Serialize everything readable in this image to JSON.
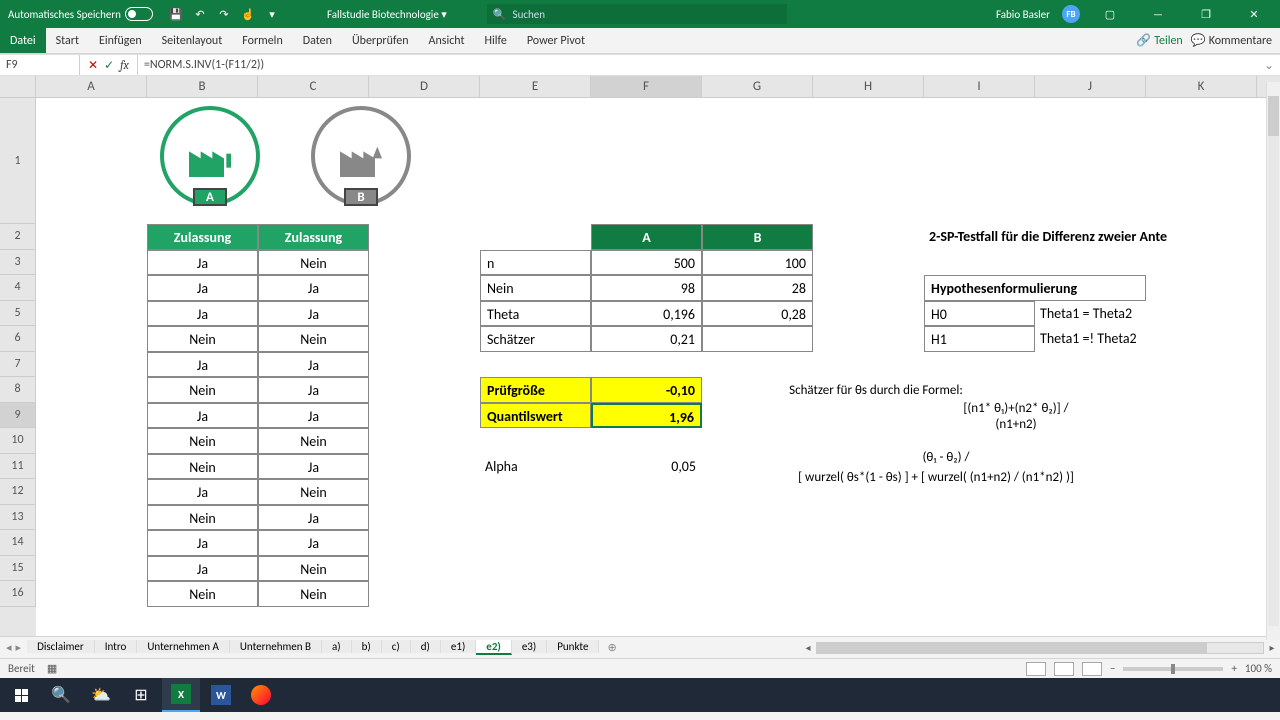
{
  "titlebar": {
    "autosave": "Automatisches Speichern",
    "docname": "Fallstudie Biotechnologie",
    "search_placeholder": "Suchen",
    "user": "Fabio Basler",
    "user_initials": "FB"
  },
  "ribbon": {
    "tabs": [
      "Datei",
      "Start",
      "Einfügen",
      "Seitenlayout",
      "Formeln",
      "Daten",
      "Überprüfen",
      "Ansicht",
      "Hilfe",
      "Power Pivot"
    ],
    "share": "Teilen",
    "comments": "Kommentare"
  },
  "formulabar": {
    "cellref": "F9",
    "formula": "=NORM.S.INV(1-(F11/2))"
  },
  "columns": [
    "A",
    "B",
    "C",
    "D",
    "E",
    "F",
    "G",
    "H",
    "I",
    "J",
    "K"
  ],
  "row_labels": [
    "1",
    "2",
    "3",
    "4",
    "5",
    "6",
    "7",
    "8",
    "9",
    "10",
    "11",
    "12",
    "13",
    "14",
    "15",
    "16"
  ],
  "data_headers": {
    "b2": "Zulassung",
    "c2": "Zulassung"
  },
  "bc_rows": [
    {
      "b": "Ja",
      "c": "Nein"
    },
    {
      "b": "Ja",
      "c": "Ja"
    },
    {
      "b": "Ja",
      "c": "Ja"
    },
    {
      "b": "Nein",
      "c": "Nein"
    },
    {
      "b": "Ja",
      "c": "Ja"
    },
    {
      "b": "Nein",
      "c": "Ja"
    },
    {
      "b": "Ja",
      "c": "Ja"
    },
    {
      "b": "Nein",
      "c": "Nein"
    },
    {
      "b": "Nein",
      "c": "Ja"
    },
    {
      "b": "Ja",
      "c": "Nein"
    },
    {
      "b": "Nein",
      "c": "Ja"
    },
    {
      "b": "Ja",
      "c": "Ja"
    },
    {
      "b": "Ja",
      "c": "Nein"
    },
    {
      "b": "Nein",
      "c": "Nein"
    }
  ],
  "stats": {
    "headA": "A",
    "headB": "B",
    "rows": [
      {
        "label": "n",
        "a": "500",
        "b": "100"
      },
      {
        "label": "Nein",
        "a": "98",
        "b": "28"
      },
      {
        "label": "Theta",
        "a": "0,196",
        "b": "0,28"
      },
      {
        "label": "Schätzer",
        "a": "0,21",
        "b": ""
      }
    ],
    "pruef_label": "Prüfgröße",
    "pruef_val": "-0,10",
    "quant_label": "Quantilswert",
    "quant_val": "1,96",
    "alpha_label": "Alpha",
    "alpha_val": "0,05"
  },
  "right": {
    "title": "2-SP-Testfall für die Differenz zweier Ante",
    "hypo": "Hypothesenformulierung",
    "h0_l": "H0",
    "h0_r": "Theta1 = Theta2",
    "h1_l": "H1",
    "h1_r": "Theta1 =! Theta2",
    "formel_intro": "Schätzer für θs durch die Formel:",
    "formel1": "[(n1* θ₁)+(n2* θ₂)] /",
    "formel2": "(n1+n2)",
    "formel3": "(θ₁ - θ₂) /",
    "formel4": "[ wurzel( θs*(1 - θs) ] + [ wurzel( (n1+n2) / (n1*n2) )]"
  },
  "sheets": [
    "Disclaimer",
    "Intro",
    "Unternehmen A",
    "Unternehmen B",
    "a)",
    "b)",
    "c)",
    "d)",
    "e1)",
    "e2)",
    "e3)",
    "Punkte"
  ],
  "active_sheet": "e2)",
  "status": {
    "ready": "Bereit",
    "zoom": "100 %"
  }
}
